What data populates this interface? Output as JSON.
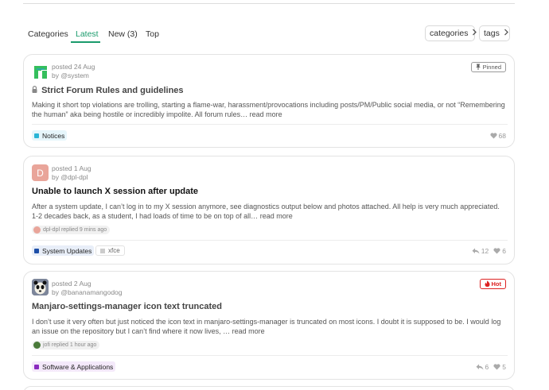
{
  "nav": {
    "tabs": [
      {
        "label": "Categories",
        "active": false
      },
      {
        "label": "Latest",
        "active": true
      },
      {
        "label": "New (3)",
        "active": false
      },
      {
        "label": "Top",
        "active": false
      }
    ],
    "categories_button": "categories",
    "tags_button": "tags",
    "accent_color": "#1a9b6c"
  },
  "topics": [
    {
      "posted": "posted 24 Aug",
      "by": "by @system",
      "badge": "Pinned",
      "locked": true,
      "title": "Strict Forum Rules and guidelines",
      "excerpt": "Making it short top violations are trolling, starting a flame-war, harassment/provocations including posts/PM/Public social media, or not “Remembering the human” aka being hostile or incredibly impolite. All forum rules…",
      "read_more": "read more",
      "category": {
        "label": "Notices",
        "color": "#2ab5d6",
        "bg": "#e6f6fb"
      },
      "likes": "68",
      "avatar_icon": "manjaro-logo-icon"
    },
    {
      "posted": "posted 1 Aug",
      "by": "by @dpl-dpl",
      "avatar_letter": "D",
      "title": "Unable to launch X session after update",
      "excerpt": "After a system update, I can’t log in to my X session anymore, see diagnostics output below and photos attached. All help is very much appreciated. 1-2 decades back, as a student, I had loads of time to be on top of all…",
      "read_more": "read more",
      "reply": "dpl-dpl replied 9 mins ago",
      "category": {
        "label": "System Updates",
        "color": "#1e4fa8",
        "bg": "#e8eef8"
      },
      "tag": "xfce",
      "replies": "12",
      "likes": "6"
    },
    {
      "posted": "posted 2 Aug",
      "by": "by @bananamangodog",
      "badge": "Hot",
      "title": "Manjaro-settings-manager icon text truncated",
      "excerpt": "I don’t use it very often but just noticed the icon text in manjaro-settings-manager is truncated on most icons. I doubt it is supposed to be. I would log an issue on the repository but I can’t find where it now lives, …",
      "read_more": "read more",
      "reply": "jofi replied 1 hour ago",
      "category": {
        "label": "Software & Applications",
        "color": "#8a2bbf",
        "bg": "#f4e9fa"
      },
      "replies": "6",
      "likes": "5",
      "avatar_icon": "panda-avatar-icon"
    }
  ]
}
